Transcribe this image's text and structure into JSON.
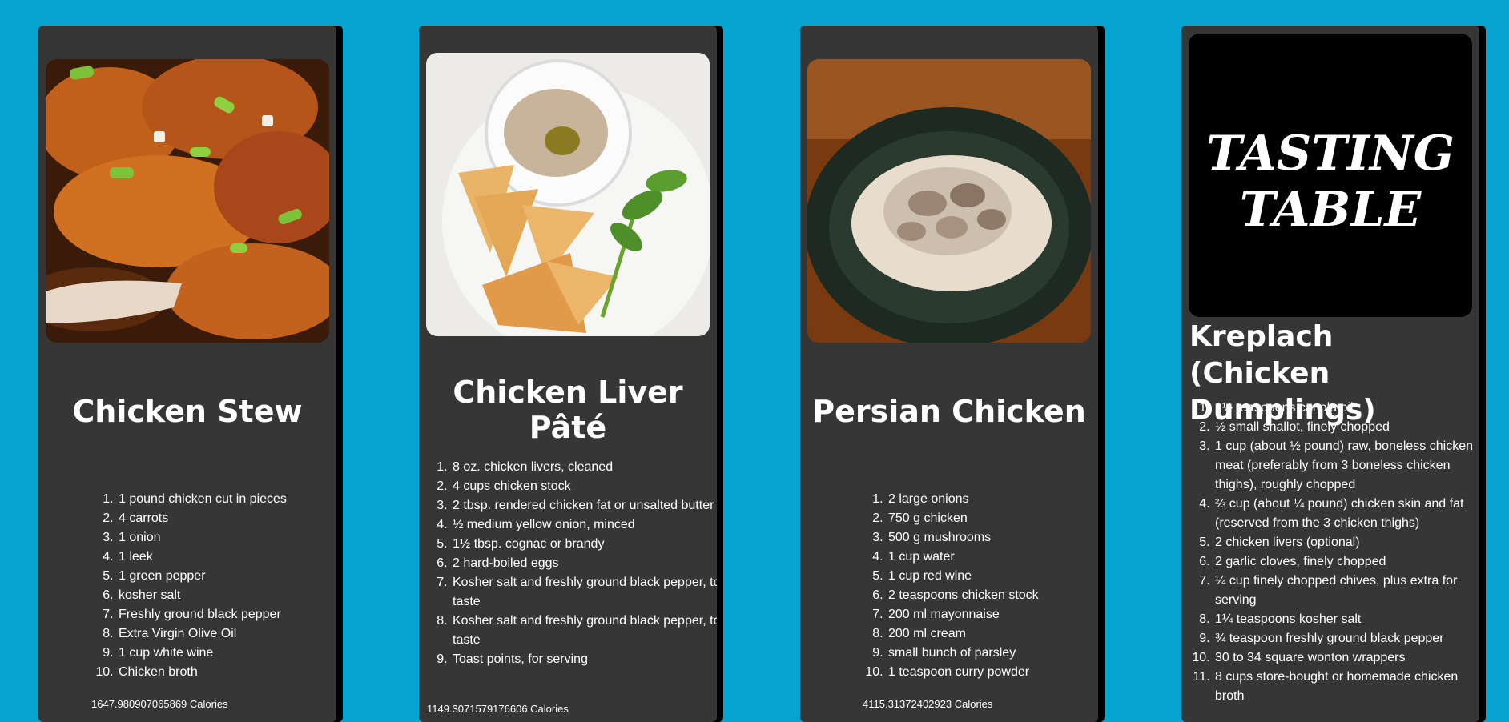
{
  "recipes": [
    {
      "title": "Chicken Stew",
      "image": "chicken-stew-photo",
      "ingredients": [
        "1 pound chicken cut in pieces",
        "4 carrots",
        "1 onion",
        "1 leek",
        "1 green pepper",
        "kosher salt",
        "Freshly ground black pepper",
        "Extra Virgin Olive Oil",
        "1 cup white wine",
        "Chicken broth"
      ],
      "calories": "1647.980907065869 Calories"
    },
    {
      "title": "Chicken Liver Pâté",
      "image": "chicken-liver-pate-photo",
      "ingredients": [
        "8 oz. chicken livers, cleaned",
        "4 cups chicken stock",
        "2 tbsp. rendered chicken fat or unsalted butter",
        "½ medium yellow onion, minced",
        "1½ tbsp. cognac or brandy",
        "2 hard-boiled eggs",
        "Kosher salt and freshly ground black pepper, to taste",
        "Kosher salt and freshly ground black pepper, to taste",
        "Toast points, for serving"
      ],
      "calories": "1149.3071579176606 Calories"
    },
    {
      "title": "Persian Chicken",
      "image": "persian-chicken-photo",
      "ingredients": [
        "2 large onions",
        "750 g chicken",
        "500 g mushrooms",
        "1 cup water",
        "1 cup red wine",
        "2 teaspoons chicken stock",
        "200 ml mayonnaise",
        "200 ml cream",
        "small bunch of parsley",
        "1 teaspoon curry powder"
      ],
      "calories": "4115.31372402923 Calories"
    },
    {
      "title": "Kreplach (Chicken Dumplings)",
      "image": "tasting-table-logo",
      "logo_text": [
        "TASTING",
        "TABLE"
      ],
      "ingredients": [
        "1½ teaspoons canola oil",
        "½ small shallot, finely chopped",
        "1 cup (about ½ pound) raw, boneless chicken meat (preferably from 3 boneless chicken thighs), roughly chopped",
        "⅔ cup (about ¼ pound) chicken skin and fat (reserved from the 3 chicken thighs)",
        "2 chicken livers (optional)",
        "2 garlic cloves, finely chopped",
        "¼ cup finely chopped chives, plus extra for serving",
        "1¼ teaspoons kosher salt",
        "¾ teaspoon freshly ground black pepper",
        "30 to 34 square wonton wrappers",
        "8 cups store-bought or homemade chicken broth"
      ]
    }
  ]
}
